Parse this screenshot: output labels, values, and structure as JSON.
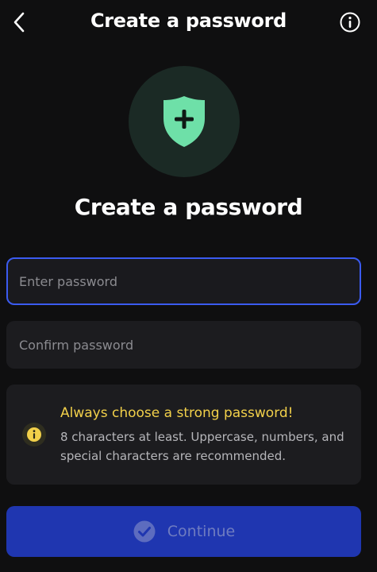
{
  "header": {
    "title": "Create a password"
  },
  "main": {
    "title": "Create a password"
  },
  "fields": {
    "password": {
      "placeholder": "Enter password",
      "value": ""
    },
    "confirm": {
      "placeholder": "Confirm password",
      "value": ""
    }
  },
  "tip": {
    "title": "Always choose a strong password!",
    "body": "8 characters at least. Uppercase, numbers, and special characters are recommended."
  },
  "actions": {
    "continue_label": "Continue"
  },
  "icons": {
    "back": "chevron-left-icon",
    "info": "info-circle-icon",
    "shield": "shield-plus-icon",
    "tip": "info-icon",
    "continue": "check-circle-icon"
  },
  "colors": {
    "background": "#0f0f10",
    "accent_green": "#6ee0a8",
    "accent_blue": "#3b5bf0",
    "button_bg": "#1f36b0",
    "tip_yellow": "#f2d04a"
  }
}
